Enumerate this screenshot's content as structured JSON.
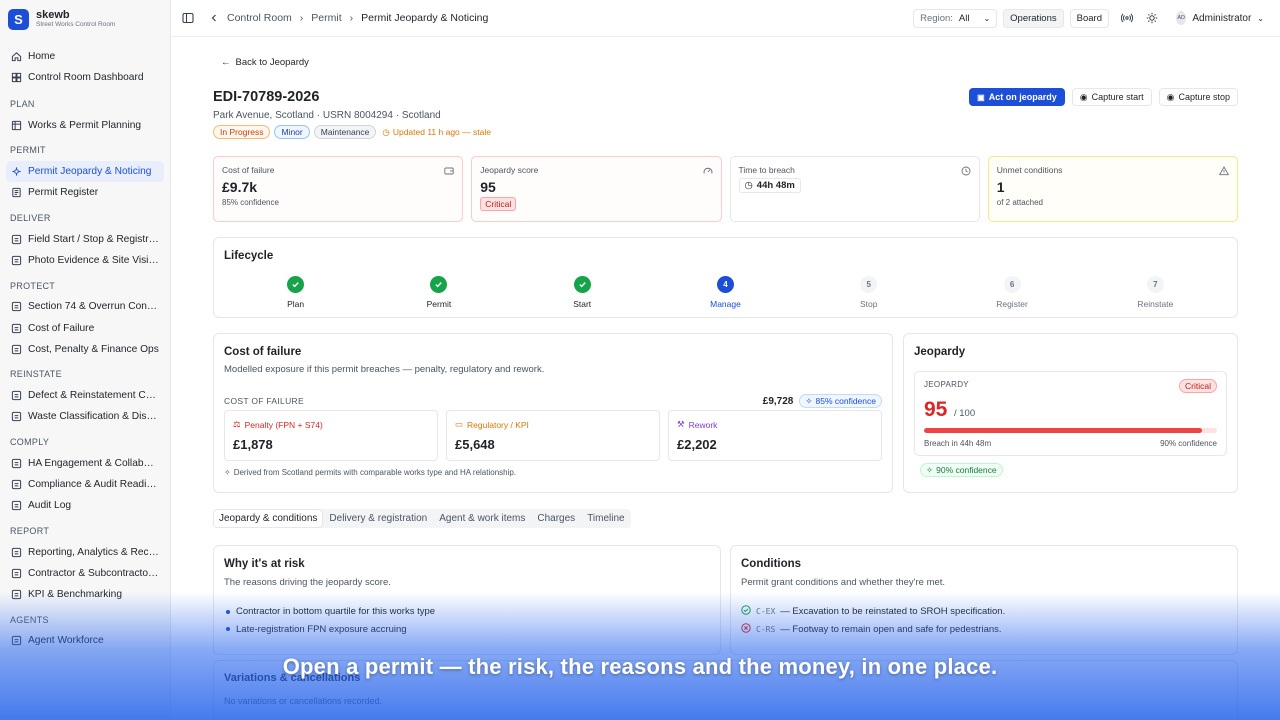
{
  "brand": {
    "logo": "S",
    "name": "skewb",
    "subtitle": "Street Works Control Room"
  },
  "sidebar": {
    "top": [
      {
        "label": "Home",
        "icon": "home-icon"
      },
      {
        "label": "Control Room Dashboard",
        "icon": "dashboard-icon"
      }
    ],
    "sections": [
      {
        "title": "PLAN",
        "items": [
          {
            "label": "Works & Permit Planning"
          }
        ]
      },
      {
        "title": "PERMIT",
        "items": [
          {
            "label": "Permit Jeopardy & Noticing",
            "active": true
          },
          {
            "label": "Permit Register"
          }
        ]
      },
      {
        "title": "DELIVER",
        "items": [
          {
            "label": "Field Start / Stop & Registrati..."
          },
          {
            "label": "Photo Evidence & Site Visibility"
          }
        ]
      },
      {
        "title": "PROTECT",
        "items": [
          {
            "label": "Section 74 & Overrun Control"
          },
          {
            "label": "Cost of Failure"
          },
          {
            "label": "Cost, Penalty & Finance Ops"
          }
        ]
      },
      {
        "title": "REINSTATE",
        "items": [
          {
            "label": "Defect & Reinstatement Contr..."
          },
          {
            "label": "Waste Classification & Dispos..."
          }
        ]
      },
      {
        "title": "COMPLY",
        "items": [
          {
            "label": "HA Engagement & Collaborati..."
          },
          {
            "label": "Compliance & Audit Readiness"
          },
          {
            "label": "Audit Log"
          }
        ]
      },
      {
        "title": "REPORT",
        "items": [
          {
            "label": "Reporting, Analytics & Records"
          },
          {
            "label": "Contractor & Subcontractor P..."
          },
          {
            "label": "KPI & Benchmarking"
          }
        ]
      },
      {
        "title": "AGENTS",
        "items": [
          {
            "label": "Agent Workforce"
          }
        ]
      }
    ]
  },
  "topbar": {
    "breadcrumb": [
      "Control Room",
      "Permit",
      "Permit Jeopardy & Noticing"
    ],
    "region_label": "Region:",
    "region_value": "All",
    "operations": "Operations",
    "board": "Board",
    "avatar_initials": "AD",
    "user": "Administrator"
  },
  "page": {
    "back": "Back to Jeopardy",
    "permit_id": "EDI-70789-2026",
    "location": "Park Avenue, Scotland · USRN 8004294 · Scotland",
    "tags": [
      "In Progress",
      "Minor",
      "Maintenance"
    ],
    "stale": "Updated 11 h ago — stale",
    "actions": {
      "act": "Act on jeopardy",
      "start": "Capture start",
      "stop": "Capture stop"
    }
  },
  "kpis": {
    "cost": {
      "title": "Cost of failure",
      "value": "£9.7k",
      "sub": "85% confidence"
    },
    "jeopardy": {
      "title": "Jeopardy score",
      "value": "95",
      "badge": "Critical"
    },
    "breach": {
      "title": "Time to breach",
      "value": "44h 48m"
    },
    "unmet": {
      "title": "Unmet conditions",
      "value": "1",
      "sub": "of 2 attached"
    }
  },
  "lifecycle": {
    "title": "Lifecycle",
    "steps": [
      {
        "num": "1",
        "label": "Plan",
        "state": "done"
      },
      {
        "num": "2",
        "label": "Permit",
        "state": "done"
      },
      {
        "num": "3",
        "label": "Start",
        "state": "done"
      },
      {
        "num": "4",
        "label": "Manage",
        "state": "active"
      },
      {
        "num": "5",
        "label": "Stop",
        "state": "todo"
      },
      {
        "num": "6",
        "label": "Register",
        "state": "todo"
      },
      {
        "num": "7",
        "label": "Reinstate",
        "state": "todo"
      }
    ]
  },
  "cost_of_failure": {
    "title": "Cost of failure",
    "subtitle": "Modelled exposure if this permit breaches — penalty, regulatory and rework.",
    "caption": "COST OF FAILURE",
    "total": "£9,728",
    "confidence": "85% confidence",
    "boxes": [
      {
        "label": "Penalty (FPN + S74)",
        "value": "£1,878",
        "color": "#dc2626"
      },
      {
        "label": "Regulatory / KPI",
        "value": "£5,648",
        "color": "#d97706"
      },
      {
        "label": "Rework",
        "value": "£2,202",
        "color": "#7c3aed"
      }
    ],
    "note": "Derived from Scotland permits with comparable works type and HA relationship."
  },
  "jeopardy": {
    "title": "Jeopardy",
    "caption": "JEOPARDY",
    "badge": "Critical",
    "score": "95",
    "of": "/ 100",
    "fraction": 0.95,
    "breach": "Breach in 44h 48m",
    "confidence": "90% confidence",
    "pill": "90% confidence"
  },
  "tabs": [
    "Jeopardy & conditions",
    "Delivery & registration",
    "Agent & work items",
    "Charges",
    "Timeline"
  ],
  "risk": {
    "title": "Why it's at risk",
    "subtitle": "The reasons driving the jeopardy score.",
    "reasons": [
      "Contractor in bottom quartile for this works type",
      "Late-registration FPN exposure accruing"
    ]
  },
  "conditions": {
    "title": "Conditions",
    "subtitle": "Permit grant conditions and whether they're met.",
    "items": [
      {
        "code": "C-EX",
        "text": "— Excavation to be reinstated to SROH specification.",
        "met": true
      },
      {
        "code": "C-RS",
        "text": "— Footway to remain open and safe for pedestrians.",
        "met": false
      }
    ]
  },
  "variations": {
    "title": "Variations & cancellations",
    "empty": "No variations or cancellations recorded."
  },
  "caption": "Open a permit — the risk, the reasons and the money, in one place."
}
